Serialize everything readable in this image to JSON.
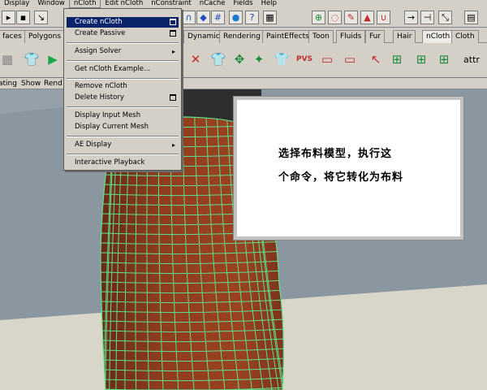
{
  "menubar": {
    "items": [
      "Display",
      "Window",
      "nCloth",
      "Edit nCloth",
      "nConstraint",
      "nCache",
      "Fields",
      "Help"
    ]
  },
  "status_icons": [
    "magnet-icon",
    "diamond-icon",
    "help-icon",
    "snap-icon",
    "render-icon",
    "lasso-icon",
    "sphere-icon",
    "question-icon"
  ],
  "shelf_tabs": [
    "faces",
    "Polygons",
    "Dynamics",
    "Rendering",
    "PaintEffects",
    "Toon",
    "Fluids",
    "Fur",
    "Hair",
    "nCloth",
    "Cloth"
  ],
  "active_tab": "nCloth",
  "panel_menu": [
    "ating",
    "Show",
    "Rend"
  ],
  "shelf_label": "attr",
  "ncloth_menu": {
    "items": [
      {
        "label": "Create nCloth",
        "kind": "option",
        "highlighted": true
      },
      {
        "label": "Create Passive",
        "kind": "option"
      },
      {
        "label": "Assign Solver",
        "kind": "submenu"
      },
      {
        "label": "Get nCloth Example...",
        "kind": "plain"
      },
      {
        "label": "Remove nCloth",
        "kind": "plain"
      },
      {
        "label": "Delete History",
        "kind": "option"
      },
      {
        "label": "Display Input Mesh",
        "kind": "plain"
      },
      {
        "label": "Display Current Mesh",
        "kind": "plain"
      },
      {
        "label": "AE Display",
        "kind": "submenu"
      },
      {
        "label": "Interactive Playback",
        "kind": "plain"
      }
    ]
  },
  "annotation": {
    "line1": "选择布料模型，执行这",
    "line2": "个命令，将它转化为布料"
  },
  "colors": {
    "ui_gray": "#d4d0c8",
    "highlight": "#0a246a",
    "cloth": "#8a3a1e",
    "wire": "#5fe08a",
    "sky": "#8a96a0",
    "floor": "#d8d6c8"
  }
}
